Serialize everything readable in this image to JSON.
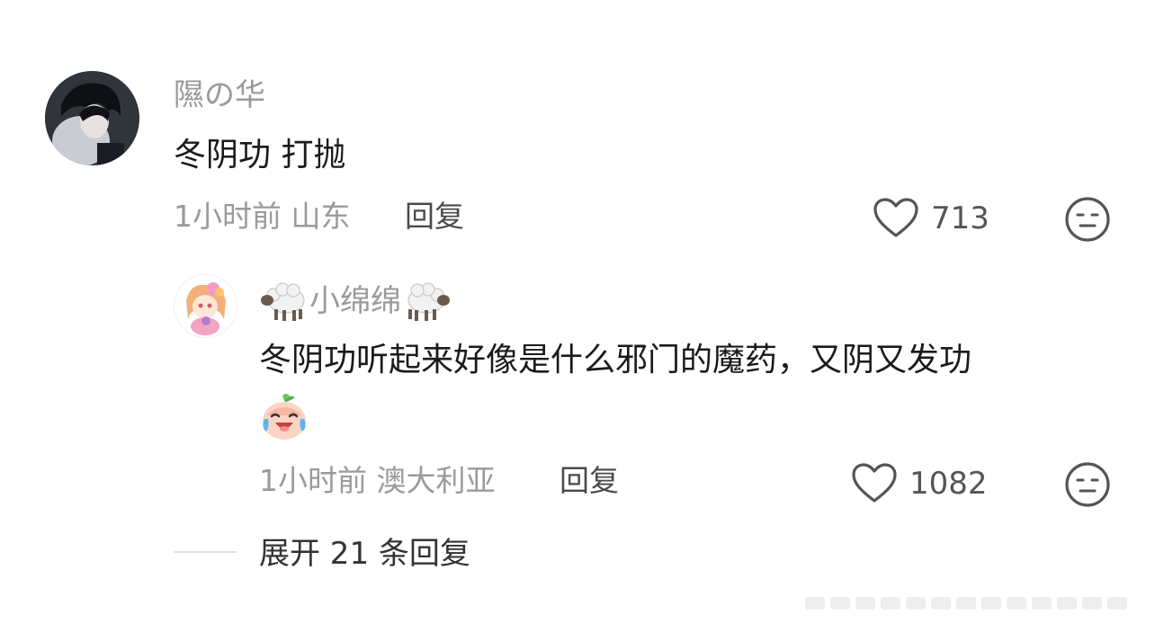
{
  "comment": {
    "username": "隰の华",
    "text": "冬阴功 打抛",
    "time": "1小时前",
    "location": "山东",
    "reply_label": "回复",
    "like_count": "713"
  },
  "reply": {
    "username": "小绵绵",
    "text": "冬阴功听起来好像是什么邪门的魔药，又阴又发功",
    "time": "1小时前",
    "location": "澳大利亚",
    "reply_label": "回复",
    "like_count": "1082"
  },
  "expand_label": "展开 21 条回复",
  "icons": {
    "like": "heart-outline-icon",
    "dislike": "neutral-face-icon",
    "username_decoration": "sheep-emoji",
    "reaction": "laugh-cry-emoji"
  },
  "colors": {
    "muted_text": "#9a9a9a",
    "body_text": "#1a1a1a",
    "icon_stroke": "#555555"
  }
}
